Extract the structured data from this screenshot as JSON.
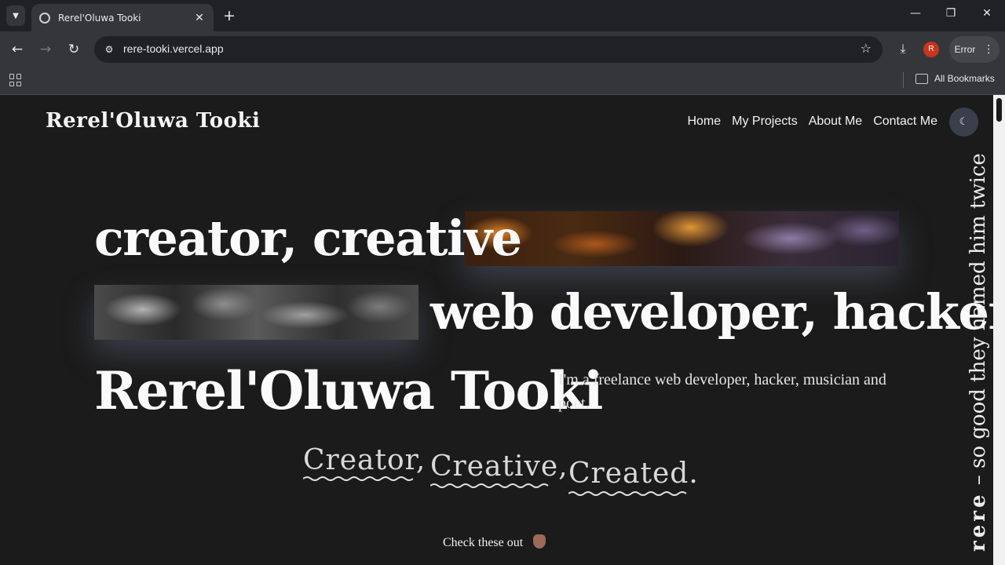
{
  "browser": {
    "tab_title": "Rerel'Oluwa Tooki",
    "url": "rere-tooki.vercel.app",
    "profile_initial": "R",
    "error_label": "Error",
    "bookmarks_label": "All Bookmarks"
  },
  "site": {
    "brand": "Rerel'Oluwa Tooki",
    "nav": [
      "Home",
      "My Projects",
      "About Me",
      "Contact Me"
    ],
    "hero": {
      "line1": "creator, creative",
      "line2": "web developer, hacker",
      "name": "Rerel'Oluwa Tooki",
      "intro": "I'm a freelance web developer, hacker, musician and poet."
    },
    "taglines": [
      "Creator,",
      "Creative,",
      "Created."
    ],
    "check_out": "Check these out",
    "vertical_bold": "rere",
    "vertical_rest": " – so good they named him twice"
  },
  "icons": {
    "tab_favicon": "favicon-icon",
    "theme_toggle": "moon-icon",
    "hand": "pointing-down-icon"
  },
  "colors": {
    "page_bg": "#1b1b1b",
    "text": "#fafafa",
    "toggle_bg": "#3a3f4b",
    "squiggle": "#e0e0e0"
  }
}
